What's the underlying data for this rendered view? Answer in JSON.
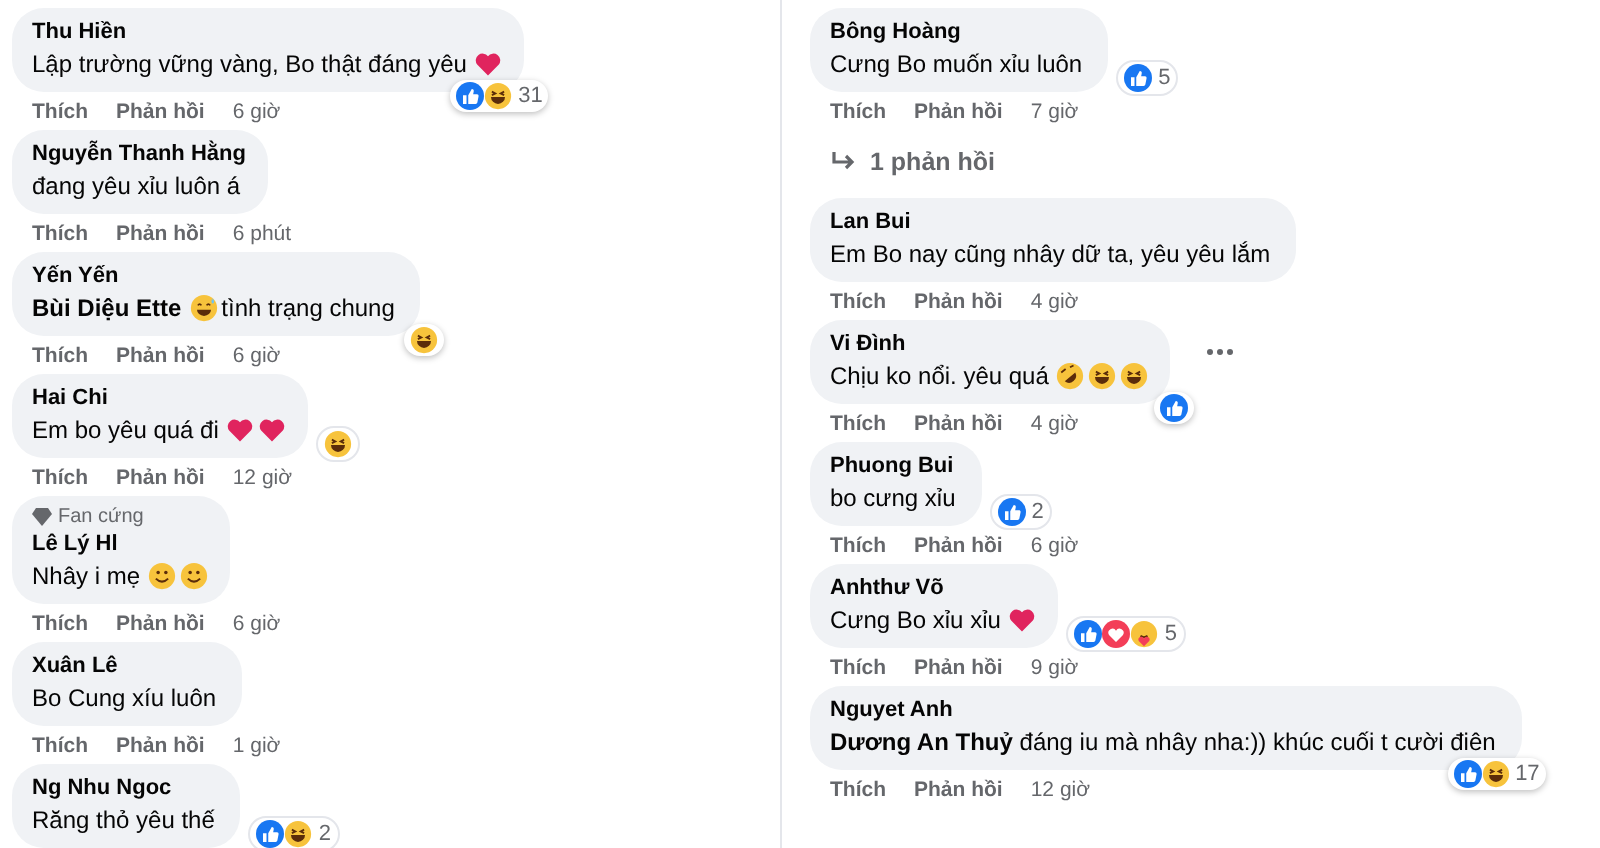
{
  "columns": [
    {
      "items": [
        {
          "kind": "comment",
          "name": "Thu Hiền",
          "body": [
            {
              "kind": "text",
              "text": "Lập trường vững vàng, Bo thật đáng yêu"
            },
            {
              "kind": "heart"
            }
          ],
          "reactions": {
            "corner": true,
            "icons": [
              {
                "kind": "like"
              },
              {
                "kind": "haha"
              }
            ],
            "count": "31"
          },
          "actions": {
            "like": "Thích",
            "reply": "Phản hồi",
            "time": "6 giờ"
          }
        },
        {
          "kind": "comment",
          "name": "Nguyễn Thanh Hằng",
          "body": [
            {
              "kind": "text",
              "text": "đang yêu xỉu luôn á"
            }
          ],
          "actions": {
            "like": "Thích",
            "reply": "Phản hồi",
            "time": "6 phút"
          }
        },
        {
          "kind": "comment",
          "name": "Yến Yến",
          "body": [
            {
              "kind": "text",
              "text": "**Bùi Diệu Ette**"
            },
            {
              "kind": "grin"
            },
            {
              "kind": "text",
              "text": "tình trạng chung"
            }
          ],
          "reactions": {
            "corner": true,
            "icons": [
              {
                "kind": "haha"
              }
            ]
          },
          "actions": {
            "like": "Thích",
            "reply": "Phản hồi",
            "time": "6 giờ"
          }
        },
        {
          "kind": "comment",
          "name": "Hai Chi",
          "body": [
            {
              "kind": "text",
              "text": "Em bo yêu quá đi"
            },
            {
              "kind": "heart"
            },
            {
              "kind": "heart"
            }
          ],
          "reactions": {
            "corner": false,
            "icons": [
              {
                "kind": "haha"
              }
            ]
          },
          "actions": {
            "like": "Thích",
            "reply": "Phản hồi",
            "time": "12 giờ"
          }
        },
        {
          "kind": "comment",
          "badge": "Fan cứng",
          "name": "Lê Lý Hl",
          "body": [
            {
              "kind": "text",
              "text": "Nhây i mẹ"
            },
            {
              "kind": "smile"
            },
            {
              "kind": "smile"
            }
          ],
          "actions": {
            "like": "Thích",
            "reply": "Phản hồi",
            "time": "6 giờ"
          }
        },
        {
          "kind": "comment",
          "name": "Xuân Lê",
          "body": [
            {
              "kind": "text",
              "text": "Bo Cung xíu luôn"
            }
          ],
          "actions": {
            "like": "Thích",
            "reply": "Phản hồi",
            "time": "1 giờ"
          }
        },
        {
          "kind": "comment",
          "name": "Ng Nhu Ngoc",
          "body": [
            {
              "kind": "text",
              "text": "Răng thỏ yêu thế"
            }
          ],
          "reactions": {
            "corner": false,
            "icons": [
              {
                "kind": "like"
              },
              {
                "kind": "haha"
              }
            ],
            "count": "2"
          }
        }
      ]
    },
    {
      "items": [
        {
          "kind": "comment",
          "name": "Bông Hoàng",
          "body": [
            {
              "kind": "text",
              "text": "Cưng Bo muốn xỉu luôn"
            }
          ],
          "reactions": {
            "corner": false,
            "icons": [
              {
                "kind": "like"
              }
            ],
            "count": "5"
          },
          "actions": {
            "like": "Thích",
            "reply": "Phản hồi",
            "time": "7 giờ"
          }
        },
        {
          "kind": "replies",
          "label": "1 phản hồi"
        },
        {
          "kind": "comment",
          "name": "Lan Bui",
          "body": [
            {
              "kind": "text",
              "text": "Em Bo nay cũng nhây dữ ta, yêu yêu lắm"
            }
          ],
          "actions": {
            "like": "Thích",
            "reply": "Phản hồi",
            "time": "4 giờ"
          }
        },
        {
          "kind": "comment",
          "name": "Vi Đình",
          "more": true,
          "body": [
            {
              "kind": "text",
              "text": "Chịu ko nổi. yêu quá"
            },
            {
              "kind": "rofl"
            },
            {
              "kind": "haha"
            },
            {
              "kind": "haha"
            }
          ],
          "reactions": {
            "corner": true,
            "icons": [
              {
                "kind": "like"
              }
            ]
          },
          "actions": {
            "like": "Thích",
            "reply": "Phản hồi",
            "time": "4 giờ"
          }
        },
        {
          "kind": "comment",
          "name": "Phuong Bui",
          "body": [
            {
              "kind": "text",
              "text": "bo cưng xỉu"
            }
          ],
          "reactions": {
            "corner": false,
            "icons": [
              {
                "kind": "like"
              }
            ],
            "count": "2"
          },
          "actions": {
            "like": "Thích",
            "reply": "Phản hồi",
            "time": "6 giờ"
          }
        },
        {
          "kind": "comment",
          "name": "Anhthư Võ",
          "body": [
            {
              "kind": "text",
              "text": "Cưng Bo xỉu xỉu"
            },
            {
              "kind": "heart"
            }
          ],
          "reactions": {
            "corner": false,
            "icons": [
              {
                "kind": "like"
              },
              {
                "kind": "love"
              },
              {
                "kind": "care"
              }
            ],
            "count": "5"
          },
          "actions": {
            "like": "Thích",
            "reply": "Phản hồi",
            "time": "9 giờ"
          }
        },
        {
          "kind": "comment",
          "name": "Nguyet Anh",
          "body": [
            {
              "kind": "text",
              "text": "**Dương An Thuỷ** đáng iu mà nhây nha:)) khúc cuối t cười điên"
            }
          ],
          "reactions": {
            "corner": true,
            "icons": [
              {
                "kind": "like"
              },
              {
                "kind": "haha"
              }
            ],
            "count": "17"
          },
          "actions": {
            "like": "Thích",
            "reply": "Phản hồi",
            "time": "12 giờ"
          }
        }
      ]
    }
  ]
}
